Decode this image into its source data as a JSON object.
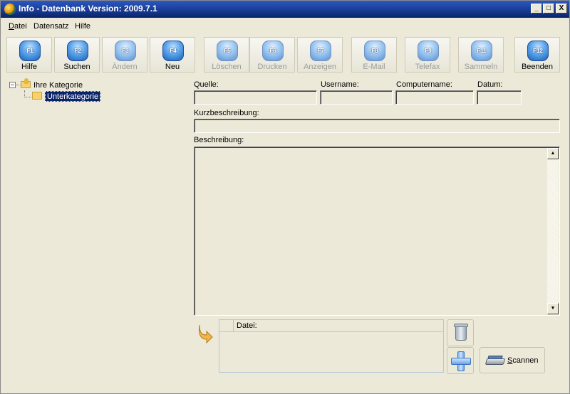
{
  "window": {
    "title": "Info - Datenbank Version: 2009.7.1",
    "controls": {
      "minimize": "_",
      "maximize": "□",
      "close": "X"
    }
  },
  "menu": [
    {
      "label": "Datei",
      "hotkey": "D",
      "rest": "atei"
    },
    {
      "label": "Datensatz",
      "hotkey": "",
      "rest": "Datensatz"
    },
    {
      "label": "Hilfe",
      "hotkey": "",
      "rest": "Hilfe"
    }
  ],
  "toolbar": [
    {
      "key": "F1",
      "label": "Hilfe",
      "enabled": true
    },
    {
      "key": "F2",
      "label": "Suchen",
      "enabled": true
    },
    {
      "key": "F3",
      "label": "Ändern",
      "enabled": false
    },
    {
      "key": "F4",
      "label": "Neu",
      "enabled": true
    },
    {
      "key": "F5",
      "label": "Löschen",
      "enabled": false
    },
    {
      "key": "F6",
      "label": "Drucken",
      "enabled": false
    },
    {
      "key": "F7",
      "label": "Anzeigen",
      "enabled": false
    },
    {
      "key": "F8",
      "label": "E-Mail",
      "enabled": false
    },
    {
      "key": "F9",
      "label": "Telefax",
      "enabled": false
    },
    {
      "key": "F11",
      "label": "Sammeln",
      "enabled": false
    },
    {
      "key": "F12",
      "label": "Beenden",
      "enabled": true
    }
  ],
  "tree": {
    "expander": "−",
    "root": "Ihre Kategorie",
    "child": "Unterkategorie"
  },
  "form": {
    "quelle_label": "Quelle:",
    "quelle_value": "",
    "username_label": "Username:",
    "username_value": "",
    "computername_label": "Computername:",
    "computername_value": "",
    "datum_label": "Datum:",
    "datum_value": "",
    "kurz_label": "Kurzbeschreibung:",
    "kurz_value": "",
    "beschreibung_label": "Beschreibung:",
    "beschreibung_value": ""
  },
  "attachments": {
    "column_header": "Datei:",
    "scan_label_hotkey": "S",
    "scan_label_rest": "cannen"
  },
  "scroll": {
    "up": "▲",
    "down": "▼"
  }
}
